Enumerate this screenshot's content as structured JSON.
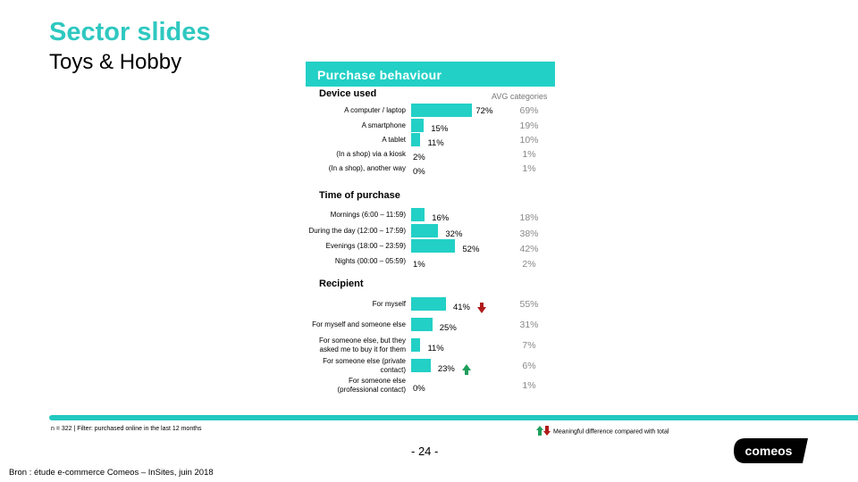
{
  "title": "Sector slides",
  "subtitle": "Toys & Hobby",
  "panel": {
    "header": "Purchase behaviour",
    "avg_label": "AVG categories"
  },
  "colors": {
    "accent": "#22d0c6",
    "title": "#2ec8c0",
    "arrow_up": "#1e9e5a",
    "arrow_down": "#b01a1a",
    "avg_text": "#888888"
  },
  "chart_data": [
    {
      "type": "bar",
      "orientation": "horizontal",
      "title": "Device used",
      "categories": [
        "A computer / laptop",
        "A smartphone",
        "A tablet",
        "(In a shop) via a kiosk",
        "(In a shop), another way"
      ],
      "series": [
        {
          "name": "Toys & Hobby",
          "values": [
            72,
            15,
            11,
            2,
            0
          ],
          "unit": "%"
        },
        {
          "name": "AVG categories",
          "values": [
            69,
            19,
            10,
            1,
            1
          ],
          "unit": "%"
        }
      ],
      "significance": [
        null,
        null,
        null,
        null,
        null
      ]
    },
    {
      "type": "bar",
      "orientation": "horizontal",
      "title": "Time of purchase",
      "categories": [
        "Mornings (6:00 – 11:59)",
        "During the day (12:00 – 17:59)",
        "Evenings (18:00 – 23:59)",
        "Nights (00:00 – 05:59)"
      ],
      "series": [
        {
          "name": "Toys & Hobby",
          "values": [
            16,
            32,
            52,
            1
          ],
          "unit": "%"
        },
        {
          "name": "AVG categories",
          "values": [
            18,
            38,
            42,
            2
          ],
          "unit": "%"
        }
      ],
      "significance": [
        null,
        null,
        null,
        null
      ]
    },
    {
      "type": "bar",
      "orientation": "horizontal",
      "title": "Recipient",
      "categories": [
        "For myself",
        "For myself and someone else",
        "For someone else, but they asked me to buy it for them",
        "For someone else (private contact)",
        "For someone else (professional contact)"
      ],
      "series": [
        {
          "name": "Toys & Hobby",
          "values": [
            41,
            25,
            11,
            23,
            0
          ],
          "unit": "%"
        },
        {
          "name": "AVG categories",
          "values": [
            55,
            31,
            7,
            6,
            1
          ],
          "unit": "%"
        }
      ],
      "significance": [
        "down",
        null,
        null,
        "up",
        null
      ]
    }
  ],
  "footer": {
    "footnote": "n = 322 | Filter: purchased online in the last 12 months",
    "legend": "Meaningful difference compared with total",
    "page": "- 24 -",
    "source": "Bron : étude e-commerce Comeos – InSites, juin 2018",
    "logo": "comeos"
  }
}
